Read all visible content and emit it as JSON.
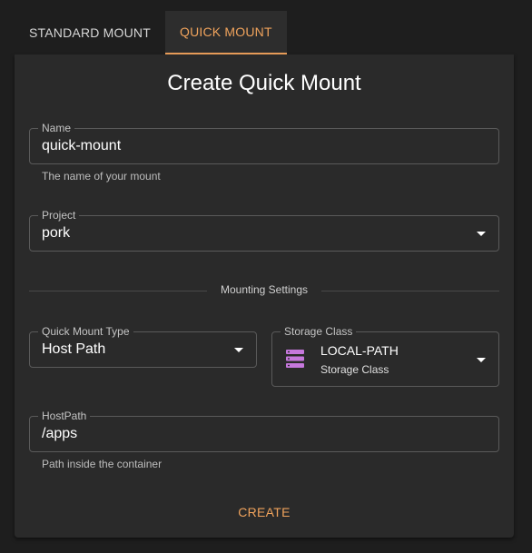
{
  "tabs": [
    {
      "label": "STANDARD MOUNT",
      "active": false
    },
    {
      "label": "QUICK MOUNT",
      "active": true
    }
  ],
  "form": {
    "title": "Create Quick Mount",
    "name": {
      "label": "Name",
      "value": "quick-mount",
      "helper": "The name of your mount"
    },
    "project": {
      "label": "Project",
      "value": "pork"
    },
    "divider_label": "Mounting Settings",
    "mount_type": {
      "label": "Quick Mount Type",
      "value": "Host Path"
    },
    "storage_class": {
      "label": "Storage Class",
      "value": "LOCAL-PATH",
      "subtitle": "Storage Class",
      "icon": "storage-server-icon"
    },
    "host_path": {
      "label": "HostPath",
      "value": "/apps",
      "helper": "Path inside the container"
    },
    "create_label": "CREATE"
  },
  "colors": {
    "accent": "#f0a35c",
    "background": "#1e1e1e",
    "card": "#2a2a2a",
    "icon": "#c678dd"
  }
}
